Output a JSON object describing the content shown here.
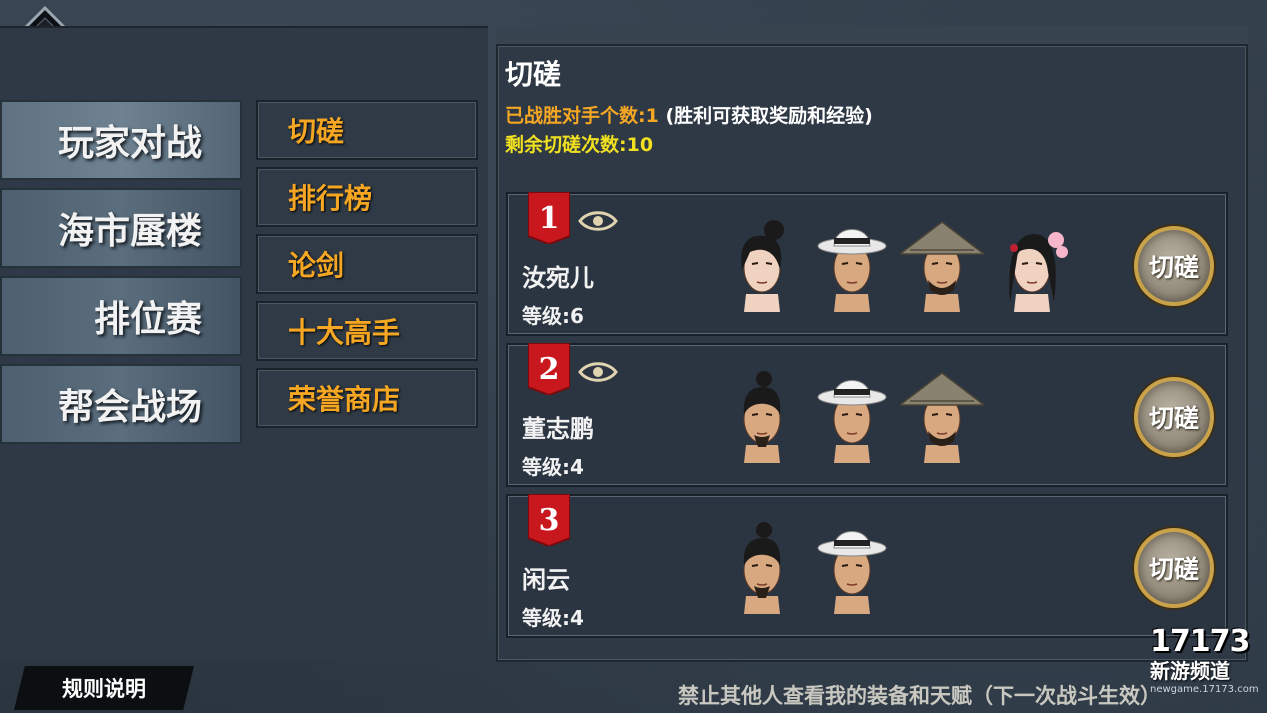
{
  "main_nav": [
    {
      "label": "玩家对战",
      "active": true
    },
    {
      "label": "海市蜃楼",
      "active": false
    },
    {
      "label": "排位赛",
      "active": false
    },
    {
      "label": "帮会战场",
      "active": false
    }
  ],
  "sub_nav": [
    {
      "label": "切磋"
    },
    {
      "label": "排行榜"
    },
    {
      "label": "论剑"
    },
    {
      "label": "十大高手"
    },
    {
      "label": "荣誉商店"
    }
  ],
  "content": {
    "title": "切磋",
    "wins_label": "已战胜对手个数:1",
    "wins_note": " (胜利可获取奖励和经验)",
    "remaining_label": "剩余切磋次数:10"
  },
  "opponents": [
    {
      "rank": "1",
      "name": "汝宛儿",
      "level": "等级:6",
      "eye_visible": true,
      "fight_label": "切磋",
      "avatars": [
        "woman-topknot",
        "man-white-hat",
        "man-straw-hat",
        "woman-flower"
      ]
    },
    {
      "rank": "2",
      "name": "董志鹏",
      "level": "等级:4",
      "eye_visible": true,
      "fight_label": "切磋",
      "avatars": [
        "man-topknot",
        "man-white-hat",
        "man-straw-hat"
      ]
    },
    {
      "rank": "3",
      "name": "闲云",
      "level": "等级:4",
      "eye_visible": false,
      "fight_label": "切磋",
      "avatars": [
        "man-topknot",
        "man-white-hat"
      ]
    }
  ],
  "footer": {
    "rules_label": "规则说明",
    "privacy_label": "禁止其他人查看我的装备和天赋（下一次战斗生效）"
  },
  "watermark": {
    "logo": "17173",
    "sub": "新游频道",
    "url": "newgame.17173.com"
  },
  "colors": {
    "accent_orange": "#f5a623",
    "accent_yellow": "#f0e020",
    "badge_red": "#c8181e",
    "fight_ring": "#c9a24a"
  },
  "icons": {
    "back": "back-arrow-icon",
    "eye": "eye-icon",
    "rank": "rank-ribbon-icon"
  }
}
